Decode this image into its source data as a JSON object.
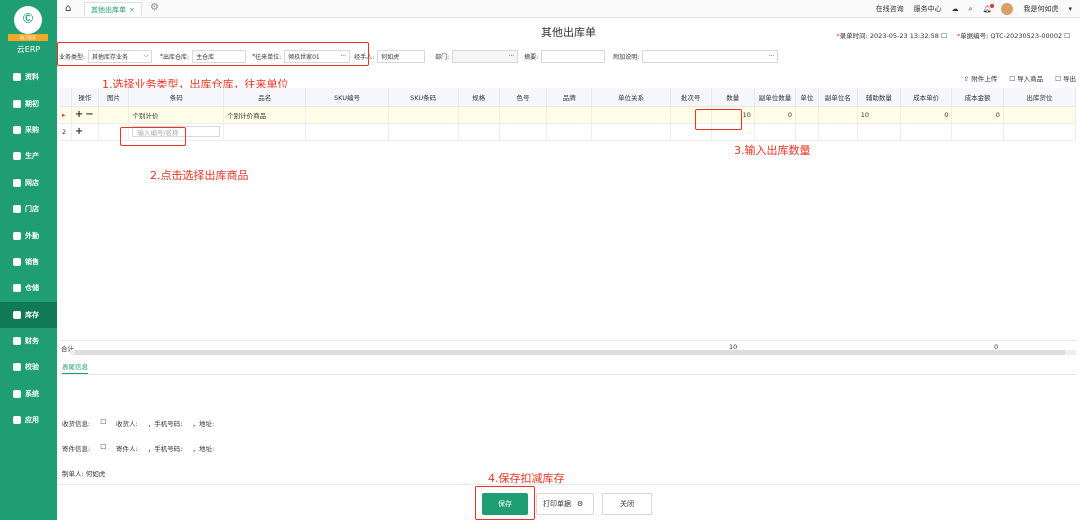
{
  "app": {
    "logo_text": "云ERP",
    "logo_badge": "精卫管家",
    "logo_glyph": "Ⓒ"
  },
  "sidebar": {
    "items": [
      {
        "label": "资料",
        "icon": "folder-icon"
      },
      {
        "label": "期初",
        "icon": "flag-icon"
      },
      {
        "label": "采购",
        "icon": "cart-icon"
      },
      {
        "label": "生产",
        "icon": "factory-icon"
      },
      {
        "label": "网店",
        "icon": "shop-icon"
      },
      {
        "label": "门店",
        "icon": "store-icon"
      },
      {
        "label": "外勤",
        "icon": "location-icon"
      },
      {
        "label": "销售",
        "icon": "sales-icon"
      },
      {
        "label": "仓储",
        "icon": "warehouse-icon"
      },
      {
        "label": "库存",
        "icon": "inventory-icon"
      },
      {
        "label": "财务",
        "icon": "finance-icon"
      },
      {
        "label": "校验",
        "icon": "check-icon"
      },
      {
        "label": "系统",
        "icon": "system-icon"
      },
      {
        "label": "应用",
        "icon": "app-icon"
      }
    ]
  },
  "tabs": {
    "home": "⌂",
    "active": "其他出库单",
    "close": "×"
  },
  "topbar": {
    "online": "在线咨询",
    "service": "服务中心",
    "user": "我是何如虎"
  },
  "doc": {
    "title": "其他出库单",
    "time_label": "录单时间:",
    "time_value": "2023-05-23 13:32:58",
    "number_label": "单据编号:",
    "number_value": "QTC-20230523-00002"
  },
  "form": {
    "biz_type_label": "业务类型:",
    "biz_type_value": "其他库存业务",
    "warehouse_label": "出库仓库:",
    "warehouse_value": "主仓库",
    "partner_label": "往来单位:",
    "partner_value": "倾玖世家01",
    "handler_label": "经手人:",
    "handler_value": "何如虎",
    "dept_label": "部门:",
    "summary_label": "摘要:",
    "extra_label": "附加说明:"
  },
  "annotations": {
    "step1": "1.选择业务类型，出库仓库，往来单位",
    "step2": "2.点击选择出库商品",
    "step3": "3.输入出库数量",
    "step4": "4.保存扣减库存"
  },
  "toolbar": {
    "attach": "附件上传",
    "import": "导入商品",
    "export": "导出"
  },
  "grid": {
    "headers": [
      "",
      "操作",
      "图片",
      "条码",
      "品名",
      "SKU编号",
      "SKU条码",
      "规格",
      "色号",
      "品牌",
      "单位关系",
      "批次号",
      "数量",
      "副单位数量",
      "单位",
      "副单位名",
      "辅助数量",
      "成本单价",
      "成本金额",
      "出库货位"
    ],
    "row1": {
      "idx": "",
      "code": "个别计价",
      "name": "个别计价商品",
      "qty": "10",
      "sub_qty": "0",
      "aux_qty": "10",
      "unit_cost": "0",
      "amount": "0"
    },
    "row2": {
      "idx": "2",
      "placeholder": "输入编号/名称"
    },
    "sum_label": "合计",
    "sum_qty": "10",
    "sum_amount": "0"
  },
  "footer": {
    "tab": "表尾信息",
    "receive_label": "收货信息:",
    "receive_text": "收货人:",
    "phone_text": "，手机号码:",
    "addr_text": "，地址:",
    "send_label": "寄件信息:",
    "send_text": "寄件人:",
    "maker": "制单人: 何如虎"
  },
  "buttons": {
    "save": "保存",
    "print": "打印单据",
    "close": "关闭"
  },
  "colors": {
    "brand": "#1f9e73",
    "alert": "#e32222"
  }
}
